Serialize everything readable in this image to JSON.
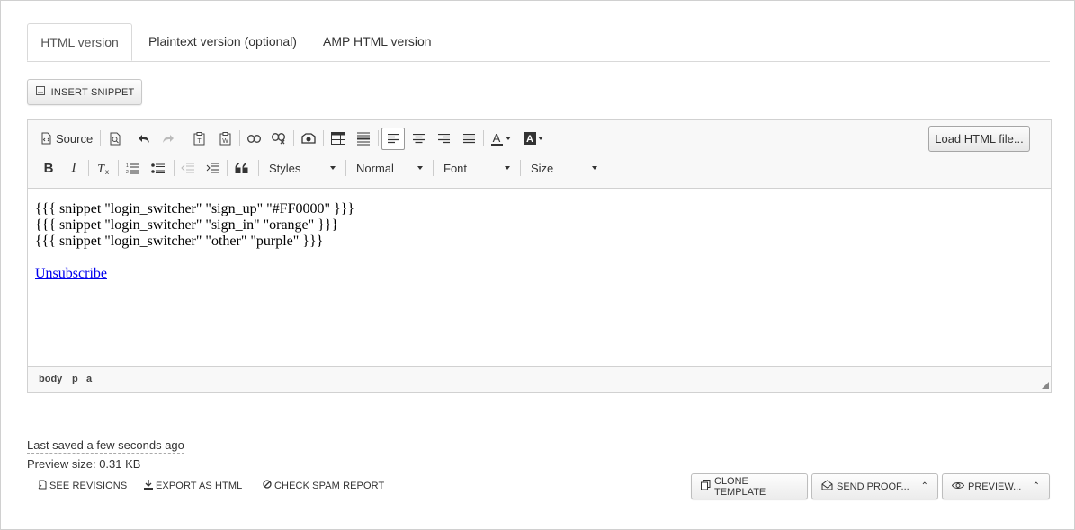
{
  "tabs": [
    {
      "label": "HTML version",
      "active": true
    },
    {
      "label": "Plaintext version (optional)",
      "active": false
    },
    {
      "label": "AMP HTML version",
      "active": false
    }
  ],
  "insert_snippet": {
    "label": "INSERT SNIPPET",
    "icon": "snippet-icon"
  },
  "toolbar": {
    "source_label": "Source",
    "styles": "Styles",
    "format": "Normal",
    "font": "Font",
    "size": "Size",
    "load_html": "Load HTML file..."
  },
  "content": {
    "lines": [
      "{{{ snippet \"login_switcher\" \"sign_up\" \"#FF0000\" }}}",
      "{{{ snippet \"login_switcher\" \"sign_in\" \"orange\" }}}",
      "{{{ snippet \"login_switcher\" \"other\" \"purple\" }}}"
    ],
    "link": "Unsubscribe"
  },
  "statusbar": {
    "path": [
      "body",
      "p",
      "a"
    ]
  },
  "footer": {
    "last_saved": "Last saved a few seconds ago",
    "preview_size": "Preview size: 0.31 KB",
    "links": {
      "revisions": "SEE REVISIONS",
      "export": "EXPORT AS HTML",
      "spam": "CHECK SPAM REPORT"
    },
    "buttons": {
      "clone": "CLONE TEMPLATE",
      "send_proof": "SEND PROOF...",
      "preview": "PREVIEW..."
    }
  },
  "colors": {
    "link": "#0000ee",
    "border": "#d1d1d1",
    "toolbar_bg": "#f8f8f8"
  }
}
